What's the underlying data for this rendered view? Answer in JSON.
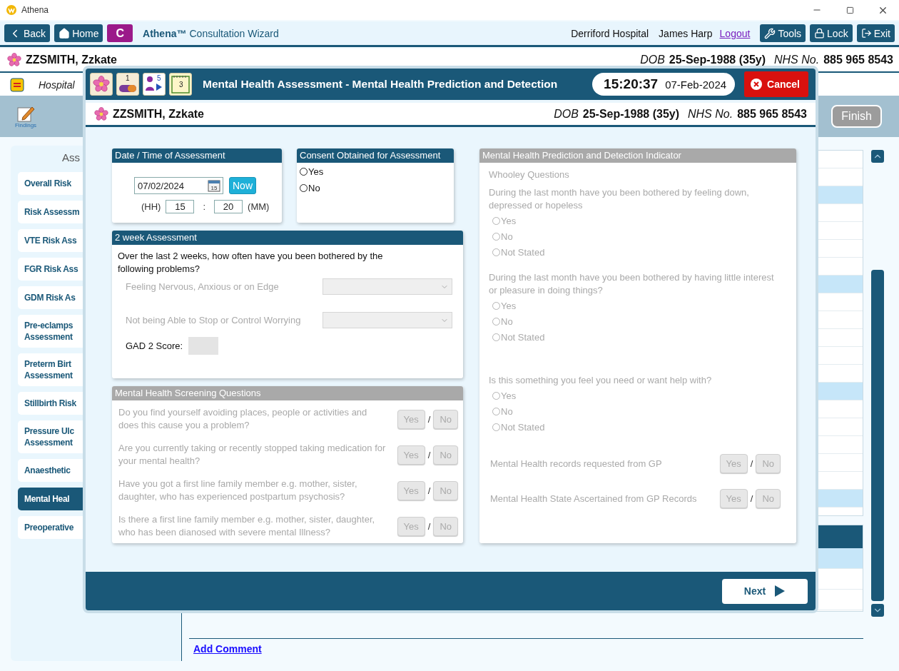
{
  "window": {
    "title": "Athena"
  },
  "toolbar": {
    "buttons": [
      {
        "label": "Back",
        "kind": "back"
      },
      {
        "label": "Home",
        "kind": "home"
      },
      {
        "label": "C",
        "kind": "badge"
      }
    ],
    "app_name": "Athena™",
    "app_subtitle": "Consultation Wizard",
    "hospital": "Derriford Hospital",
    "user": "James Harp",
    "logout": "Logout",
    "actions": [
      {
        "label": "Tools",
        "kind": "tools"
      },
      {
        "label": "Lock",
        "kind": "lock"
      },
      {
        "label": "Exit",
        "kind": "exit"
      }
    ]
  },
  "patient_bar": {
    "name": "ZZSMITH, Zzkate",
    "dob_label": "DOB",
    "dob": "25-Sep-1988 (35y)",
    "nhs_label": "NHS No.",
    "nhs": "885 965 8543"
  },
  "hospital_bar": {
    "text": "Hospital"
  },
  "findings_toolbar": {
    "label": "Findings",
    "finish": "Finish"
  },
  "sidebar": {
    "heading": "Ass",
    "items": [
      {
        "lines": [
          "Overall Risk"
        ],
        "selected": false
      },
      {
        "lines": [
          "Risk Assessm"
        ],
        "selected": false
      },
      {
        "lines": [
          "VTE Risk Ass"
        ],
        "selected": false
      },
      {
        "lines": [
          "FGR Risk Ass"
        ],
        "selected": false
      },
      {
        "lines": [
          "GDM Risk As"
        ],
        "selected": false
      },
      {
        "lines": [
          "Pre-eclamps",
          "Assessment"
        ],
        "selected": false
      },
      {
        "lines": [
          "Preterm Birt",
          "Assessment"
        ],
        "selected": false
      },
      {
        "lines": [
          "Stillbirth Risk"
        ],
        "selected": false
      },
      {
        "lines": [
          "Pressure Ulc",
          "Assessment"
        ],
        "selected": false
      },
      {
        "lines": [
          "Anaesthetic"
        ],
        "selected": false
      },
      {
        "lines": [
          "Mental Heal"
        ],
        "selected": true
      },
      {
        "lines": [
          "Preoperative"
        ],
        "selected": false
      }
    ]
  },
  "background_table": {
    "rows": [
      {
        "highlighted": false
      },
      {
        "highlighted": false
      },
      {
        "highlighted": true
      },
      {
        "highlighted": false
      },
      {
        "highlighted": false
      },
      {
        "highlighted": false
      },
      {
        "highlighted": false
      },
      {
        "highlighted": true
      },
      {
        "highlighted": false
      },
      {
        "highlighted": false
      },
      {
        "highlighted": false
      },
      {
        "highlighted": false
      },
      {
        "highlighted": false
      },
      {
        "highlighted": true
      },
      {
        "highlighted": false
      },
      {
        "highlighted": false
      },
      {
        "highlighted": false
      },
      {
        "highlighted": false
      },
      {
        "highlighted": false
      },
      {
        "highlighted": true
      }
    ],
    "lower_rows": [
      {
        "highlighted": true
      },
      {
        "highlighted": false
      },
      {
        "highlighted": false
      }
    ]
  },
  "add_comment": "Add Comment",
  "modal": {
    "badges": [
      {
        "kind": "flower"
      },
      {
        "kind": "pill",
        "count": "1"
      },
      {
        "kind": "people",
        "count": "5"
      },
      {
        "kind": "note",
        "count": "3"
      }
    ],
    "title": "Mental Health Assessment - Mental Health Prediction and Detection",
    "time": "15:20:37",
    "date": "07-Feb-2024",
    "cancel": "Cancel",
    "patient": {
      "name": "ZZSMITH, Zzkate",
      "dob_label": "DOB",
      "dob": "25-Sep-1988 (35y)",
      "nhs_label": "NHS No.",
      "nhs": "885 965 8543"
    },
    "datetime_panel": {
      "title": "Date / Time of Assessment",
      "date": "07/02/2024",
      "calendar_day": "15",
      "now": "Now",
      "hh_label": "(HH)",
      "hh": "15",
      "separator": ":",
      "mm": "20",
      "mm_label": "(MM)"
    },
    "consent_panel": {
      "title": "Consent Obtained for Assessment",
      "options": [
        {
          "label": "Yes",
          "selected": false
        },
        {
          "label": "No",
          "selected": false
        }
      ]
    },
    "two_week_panel": {
      "title": "2 week Assessment",
      "intro": "Over the last 2 weeks, how often have you been bothered by the following problems?",
      "questions": [
        {
          "label": "Feeling Nervous, Anxious or on Edge",
          "disabled": true
        },
        {
          "label": "Not being Able to Stop or Control Worrying",
          "disabled": true
        }
      ],
      "score_label": "GAD 2 Score:"
    },
    "screening_panel": {
      "title": "Mental Health Screening Questions",
      "disabled": true,
      "questions": [
        {
          "text": "Do you find yourself avoiding places, people or activities and does this cause you a problem?",
          "yes": "Yes",
          "separator": "/",
          "no": "No"
        },
        {
          "text": "Are you currently taking or recently stopped taking medication for your mental health?",
          "yes": "Yes",
          "separator": "/",
          "no": "No"
        },
        {
          "text": "Have you got a first line family member e.g. mother, sister, daughter, who has experienced postpartum psychosis?",
          "yes": "Yes",
          "separator": "/",
          "no": "No"
        },
        {
          "text": "Is there a first line family member e.g. mother, sister, daughter, who has been dianosed with severe mental Illness?",
          "yes": "Yes",
          "separator": "/",
          "no": "No"
        }
      ]
    },
    "indicator_panel": {
      "title": "Mental Health Prediction and Detection Indicator",
      "disabled": true,
      "heading": "Whooley Questions",
      "groups": [
        {
          "question": "During the last month have you been bothered by feeling down, depressed or hopeless",
          "options": [
            {
              "label": "Yes",
              "selected": false
            },
            {
              "label": "No",
              "selected": false
            },
            {
              "label": "Not Stated",
              "selected": false
            }
          ]
        },
        {
          "question": "During the last month have you been bothered by having little interest or pleasure in doing things?",
          "options": [
            {
              "label": "Yes",
              "selected": false
            },
            {
              "label": "No",
              "selected": false
            },
            {
              "label": "Not Stated",
              "selected": false
            }
          ]
        },
        {
          "question": "Is this something you feel you need or want help with?",
          "options": [
            {
              "label": "Yes",
              "selected": false
            },
            {
              "label": "No",
              "selected": false
            },
            {
              "label": "Not Stated",
              "selected": false
            }
          ]
        }
      ],
      "records": [
        {
          "text": "Mental Health records requested from GP",
          "yes": "Yes",
          "separator": "/",
          "no": "No"
        },
        {
          "text": "Mental Health State Ascertained from GP Records",
          "yes": "Yes",
          "separator": "/",
          "no": "No"
        }
      ]
    },
    "next": "Next"
  }
}
